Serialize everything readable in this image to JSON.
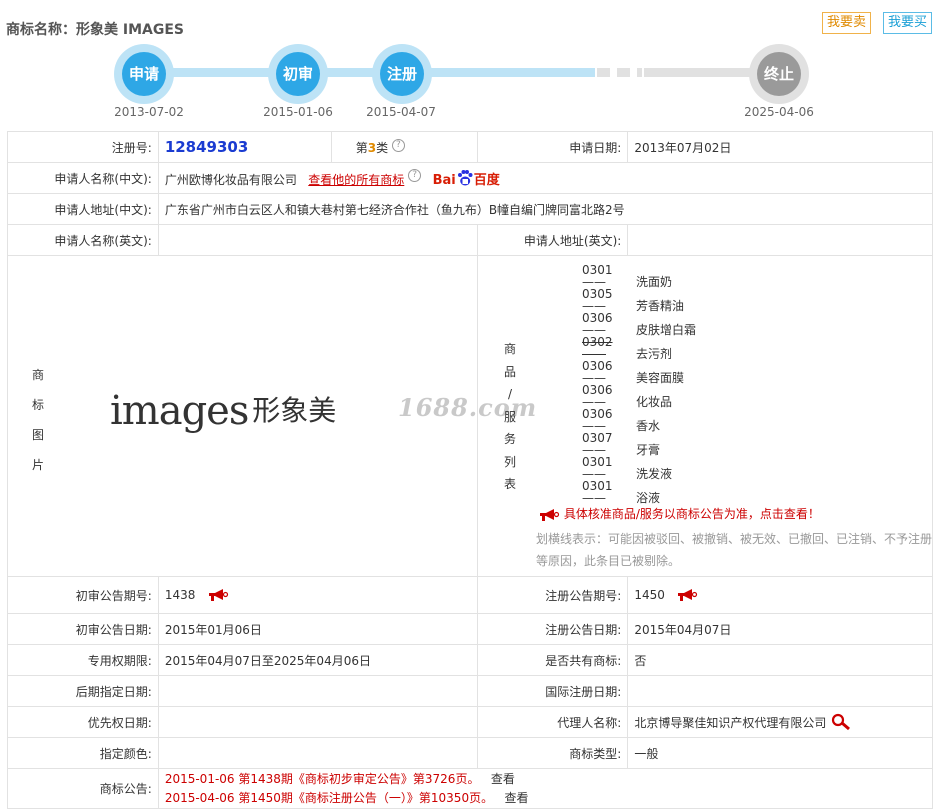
{
  "header": {
    "title": "商标名称：形象美 IMAGES",
    "sell_label": "我要卖",
    "buy_label": "我要买"
  },
  "timeline": {
    "steps": [
      {
        "label": "申请",
        "date": "2013-07-02"
      },
      {
        "label": "初审",
        "date": "2015-01-06"
      },
      {
        "label": "注册",
        "date": "2015-04-07"
      },
      {
        "label": "终止",
        "date": "2025-04-06"
      }
    ],
    "colors": {
      "active": "#2ea7e6",
      "active_ring": "#bde3f6",
      "pending": "#9a9a9a"
    }
  },
  "info": {
    "reg_no_label": "注册号:",
    "reg_no": "12849303",
    "class_prefix": "第",
    "class_num": "3",
    "class_suffix": "类",
    "apply_date_label": "申请日期:",
    "apply_date": "2013年07月02日",
    "applicant_cn_label": "申请人名称(中文):",
    "applicant_cn": "广州欧博化妆品有限公司",
    "view_all_link": "查看他的所有商标",
    "baidu_text": "Bai",
    "baidu_text2": "百度",
    "address_cn_label": "申请人地址(中文):",
    "address_cn": "广东省广州市白云区人和镇大巷村第七经济合作社（鱼九布）B幢自编门牌同富北路2号",
    "applicant_en_label": "申请人名称(英文):",
    "applicant_en": "",
    "address_en_label": "申请人地址(英文):",
    "address_en": "",
    "logo_label_chars": [
      "商",
      "标",
      "图",
      "片"
    ],
    "logo_text_latin": "images",
    "logo_text_cn": "形象美",
    "watermark": "1688.com",
    "goods_label_chars": [
      "商",
      "品",
      "/",
      "服",
      "务",
      "列",
      "表"
    ],
    "goods": [
      {
        "code": "0301——",
        "name": "洗面奶",
        "struck": false
      },
      {
        "code": "0305——",
        "name": "芳香精油",
        "struck": false
      },
      {
        "code": "0306——",
        "name": "皮肤增白霜",
        "struck": false
      },
      {
        "code": "0302——",
        "name": "去污剂",
        "struck": true
      },
      {
        "code": "0306——",
        "name": "美容面膜",
        "struck": false
      },
      {
        "code": "0306——",
        "name": "化妆品",
        "struck": false
      },
      {
        "code": "0306——",
        "name": "香水",
        "struck": false
      },
      {
        "code": "0307——",
        "name": "牙膏",
        "struck": false
      },
      {
        "code": "0301——",
        "name": "洗发液",
        "struck": false
      },
      {
        "code": "0301——",
        "name": "浴液",
        "struck": false
      }
    ],
    "goods_notice": "具体核准商品/服务以商标公告为准，点击查看！",
    "goods_note": "划横线表示：可能因被驳回、被撤销、被无效、已撤回、已注销、不予注册等原因，此条目已被剔除。",
    "prelim_no_label": "初审公告期号:",
    "prelim_no": "1438",
    "reg_notice_no_label": "注册公告期号:",
    "reg_notice_no": "1450",
    "prelim_date_label": "初审公告日期:",
    "prelim_date": "2015年01月06日",
    "reg_notice_date_label": "注册公告日期:",
    "reg_notice_date": "2015年04月07日",
    "exclusive_label": "专用权期限:",
    "exclusive": "2015年04月07日至2025年04月06日",
    "shared_label": "是否共有商标:",
    "shared": "否",
    "later_date_label": "后期指定日期:",
    "later_date": "",
    "intl_date_label": "国际注册日期:",
    "intl_date": "",
    "priority_label": "优先权日期:",
    "priority": "",
    "agent_label": "代理人名称:",
    "agent": "北京博导聚佳知识产权代理有限公司",
    "color_label": "指定颜色:",
    "color": "",
    "type_label": "商标类型:",
    "type": "一般",
    "announce_label": "商标公告:",
    "announcements": [
      {
        "text": "2015-01-06 第1438期《商标初步审定公告》第3726页。",
        "view": "查看"
      },
      {
        "text": "2015-04-06 第1450期《商标注册公告（一）》第10350页。",
        "view": "查看"
      }
    ]
  }
}
